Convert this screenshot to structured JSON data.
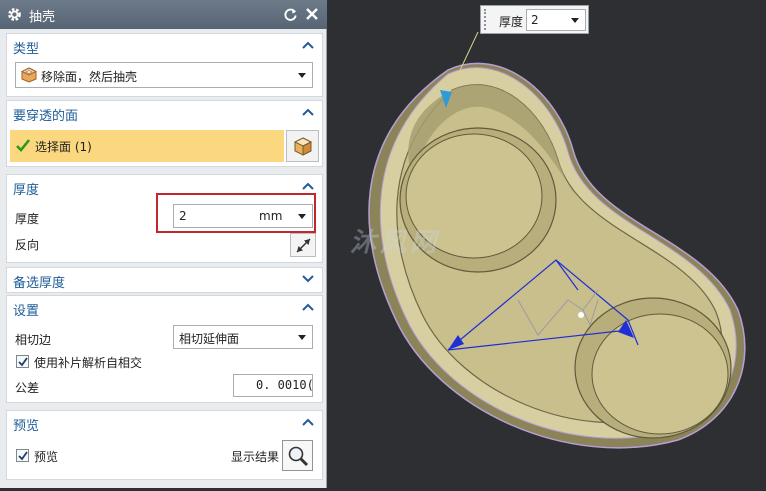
{
  "dialog": {
    "title": "抽壳",
    "type_section": {
      "title": "类型",
      "value": "移除面，然后抽壳"
    },
    "faces_section": {
      "title": "要穿透的面",
      "select_label": "选择面 (1)"
    },
    "thickness_section": {
      "title": "厚度",
      "thickness_label": "厚度",
      "thickness_value": "2",
      "thickness_unit": "mm",
      "reverse_label": "反向"
    },
    "alt_thickness_section": {
      "title": "备选厚度"
    },
    "settings_section": {
      "title": "设置",
      "tangent_label": "相切边",
      "tangent_value": "相切延伸面",
      "patch_label": "使用补片解析自相交",
      "patch_checked": true,
      "tolerance_label": "公差",
      "tolerance_value": "0. 0010("
    },
    "preview_section": {
      "title": "预览",
      "preview_label": "预览",
      "preview_checked": true,
      "show_result_label": "显示结果"
    }
  },
  "viewport": {
    "float_label": "厚度",
    "float_value": "2",
    "watermark": "沐风网"
  },
  "colors": {
    "title_bar": "#5e6d7d",
    "section_title": "#1f5d99",
    "selected_row": "#fbd87f",
    "highlight_box": "#c0282d",
    "viewport_bg": "#2e2f33",
    "part_fill": "#c9bf8c",
    "dimension_lines": "#1f2fd6"
  }
}
